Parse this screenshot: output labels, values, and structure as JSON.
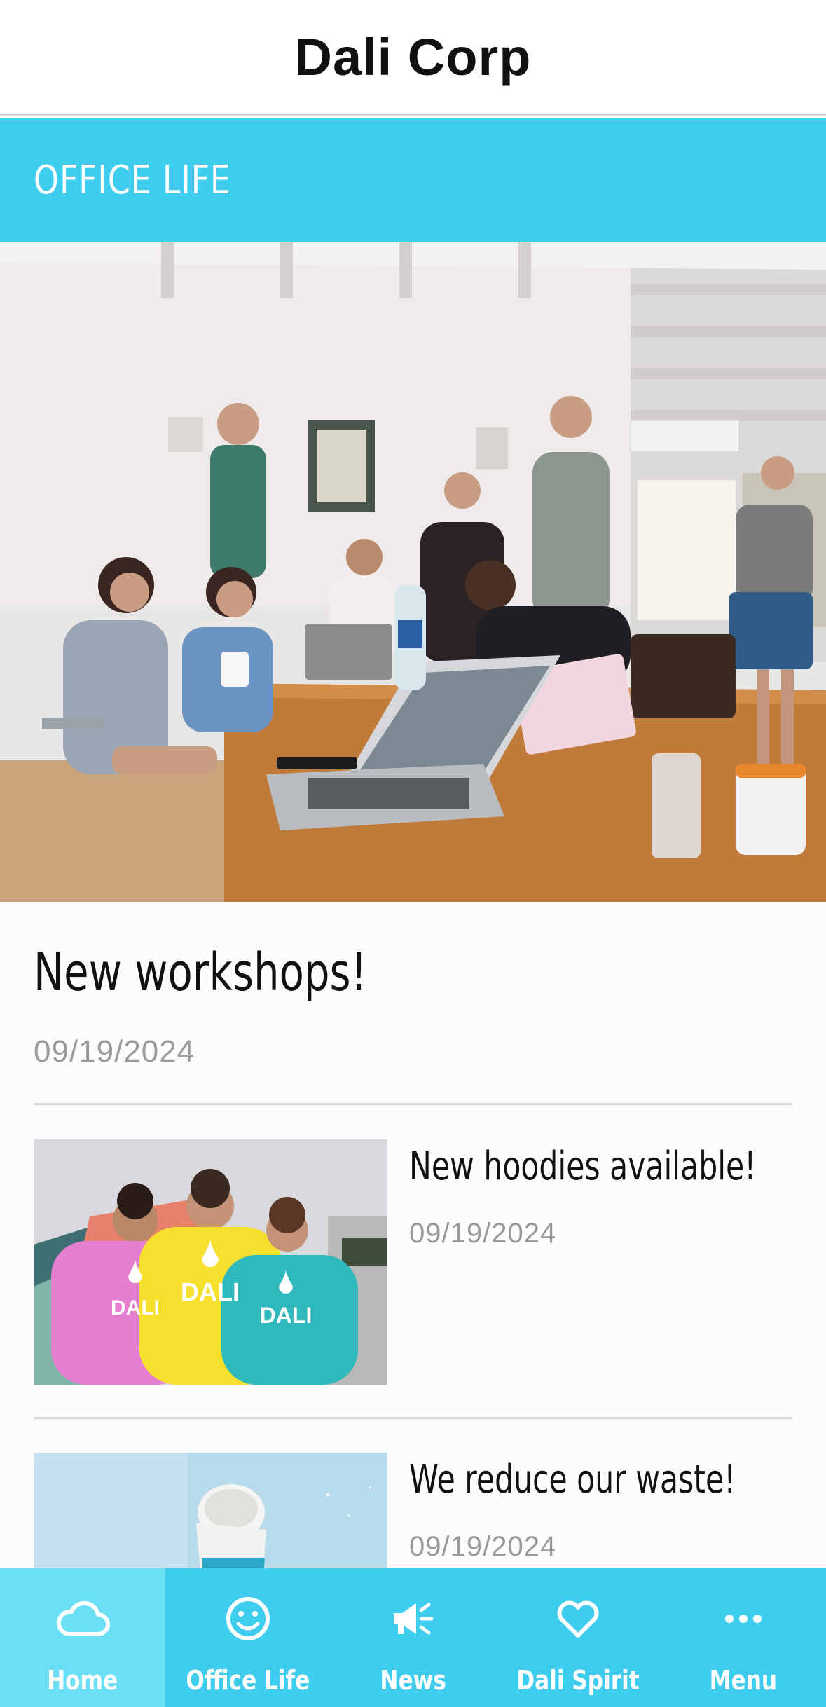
{
  "header": {
    "title": "Dali Corp"
  },
  "section": {
    "title": "OFFICE LIFE"
  },
  "feature": {
    "title": "New workshops!",
    "date": "09/19/2024"
  },
  "articles": [
    {
      "title": "New hoodies available!",
      "date": "09/19/2024",
      "hoodie_text": "DALI"
    },
    {
      "title": "We reduce our waste!",
      "date": "09/19/2024"
    }
  ],
  "tabs": [
    {
      "label": "Home",
      "icon": "cloud-icon",
      "active": true
    },
    {
      "label": "Office Life",
      "icon": "smiley-icon",
      "active": false
    },
    {
      "label": "News",
      "icon": "megaphone-icon",
      "active": false
    },
    {
      "label": "Dali Spirit",
      "icon": "heart-icon",
      "active": false
    },
    {
      "label": "Menu",
      "icon": "more-dots-icon",
      "active": false
    }
  ],
  "colors": {
    "accent": "#3ecdee",
    "active_tab": "#6adff6",
    "muted_text": "#9a9a9a"
  }
}
